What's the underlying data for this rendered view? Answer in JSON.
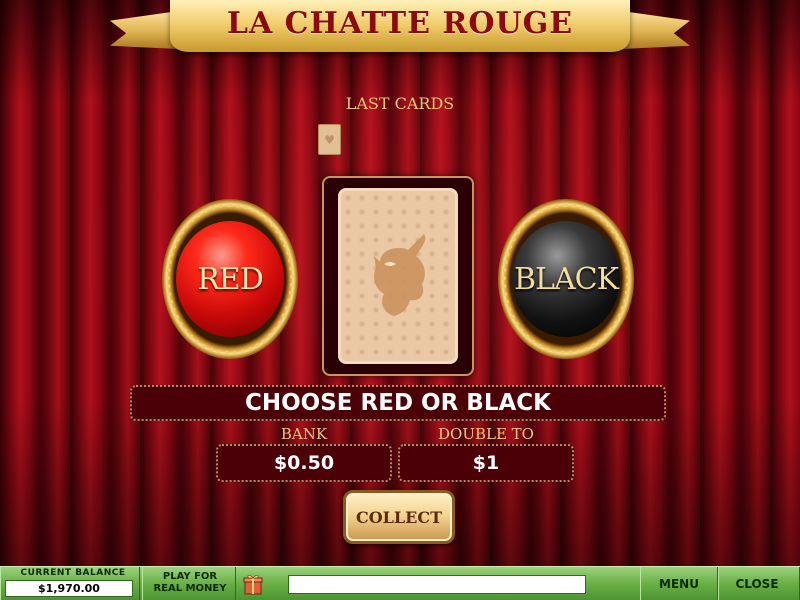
{
  "game": {
    "title": "LA CHATTE ROUGE"
  },
  "last_cards": {
    "label": "LAST CARDS",
    "cards": [
      "card-back"
    ]
  },
  "choices": {
    "red_label": "RED",
    "black_label": "BLACK"
  },
  "message": "CHOOSE RED OR BLACK",
  "bank": {
    "label": "BANK",
    "value": "$0.50"
  },
  "double_to": {
    "label": "DOUBLE TO",
    "value": "$1"
  },
  "collect_label": "COLLECT",
  "bottom_bar": {
    "balance_label": "CURRENT BALANCE",
    "balance_value": "$1,970.00",
    "play_real_line1": "PLAY FOR",
    "play_real_line2": "REAL MONEY",
    "gift_icon": "gift-icon",
    "message_field_value": "",
    "menu_label": "MENU",
    "close_label": "CLOSE"
  },
  "colors": {
    "curtain": "#8a0812",
    "gold": "#f1cd6e",
    "panel": "#4a0006",
    "bar_green": "#6ab046"
  }
}
